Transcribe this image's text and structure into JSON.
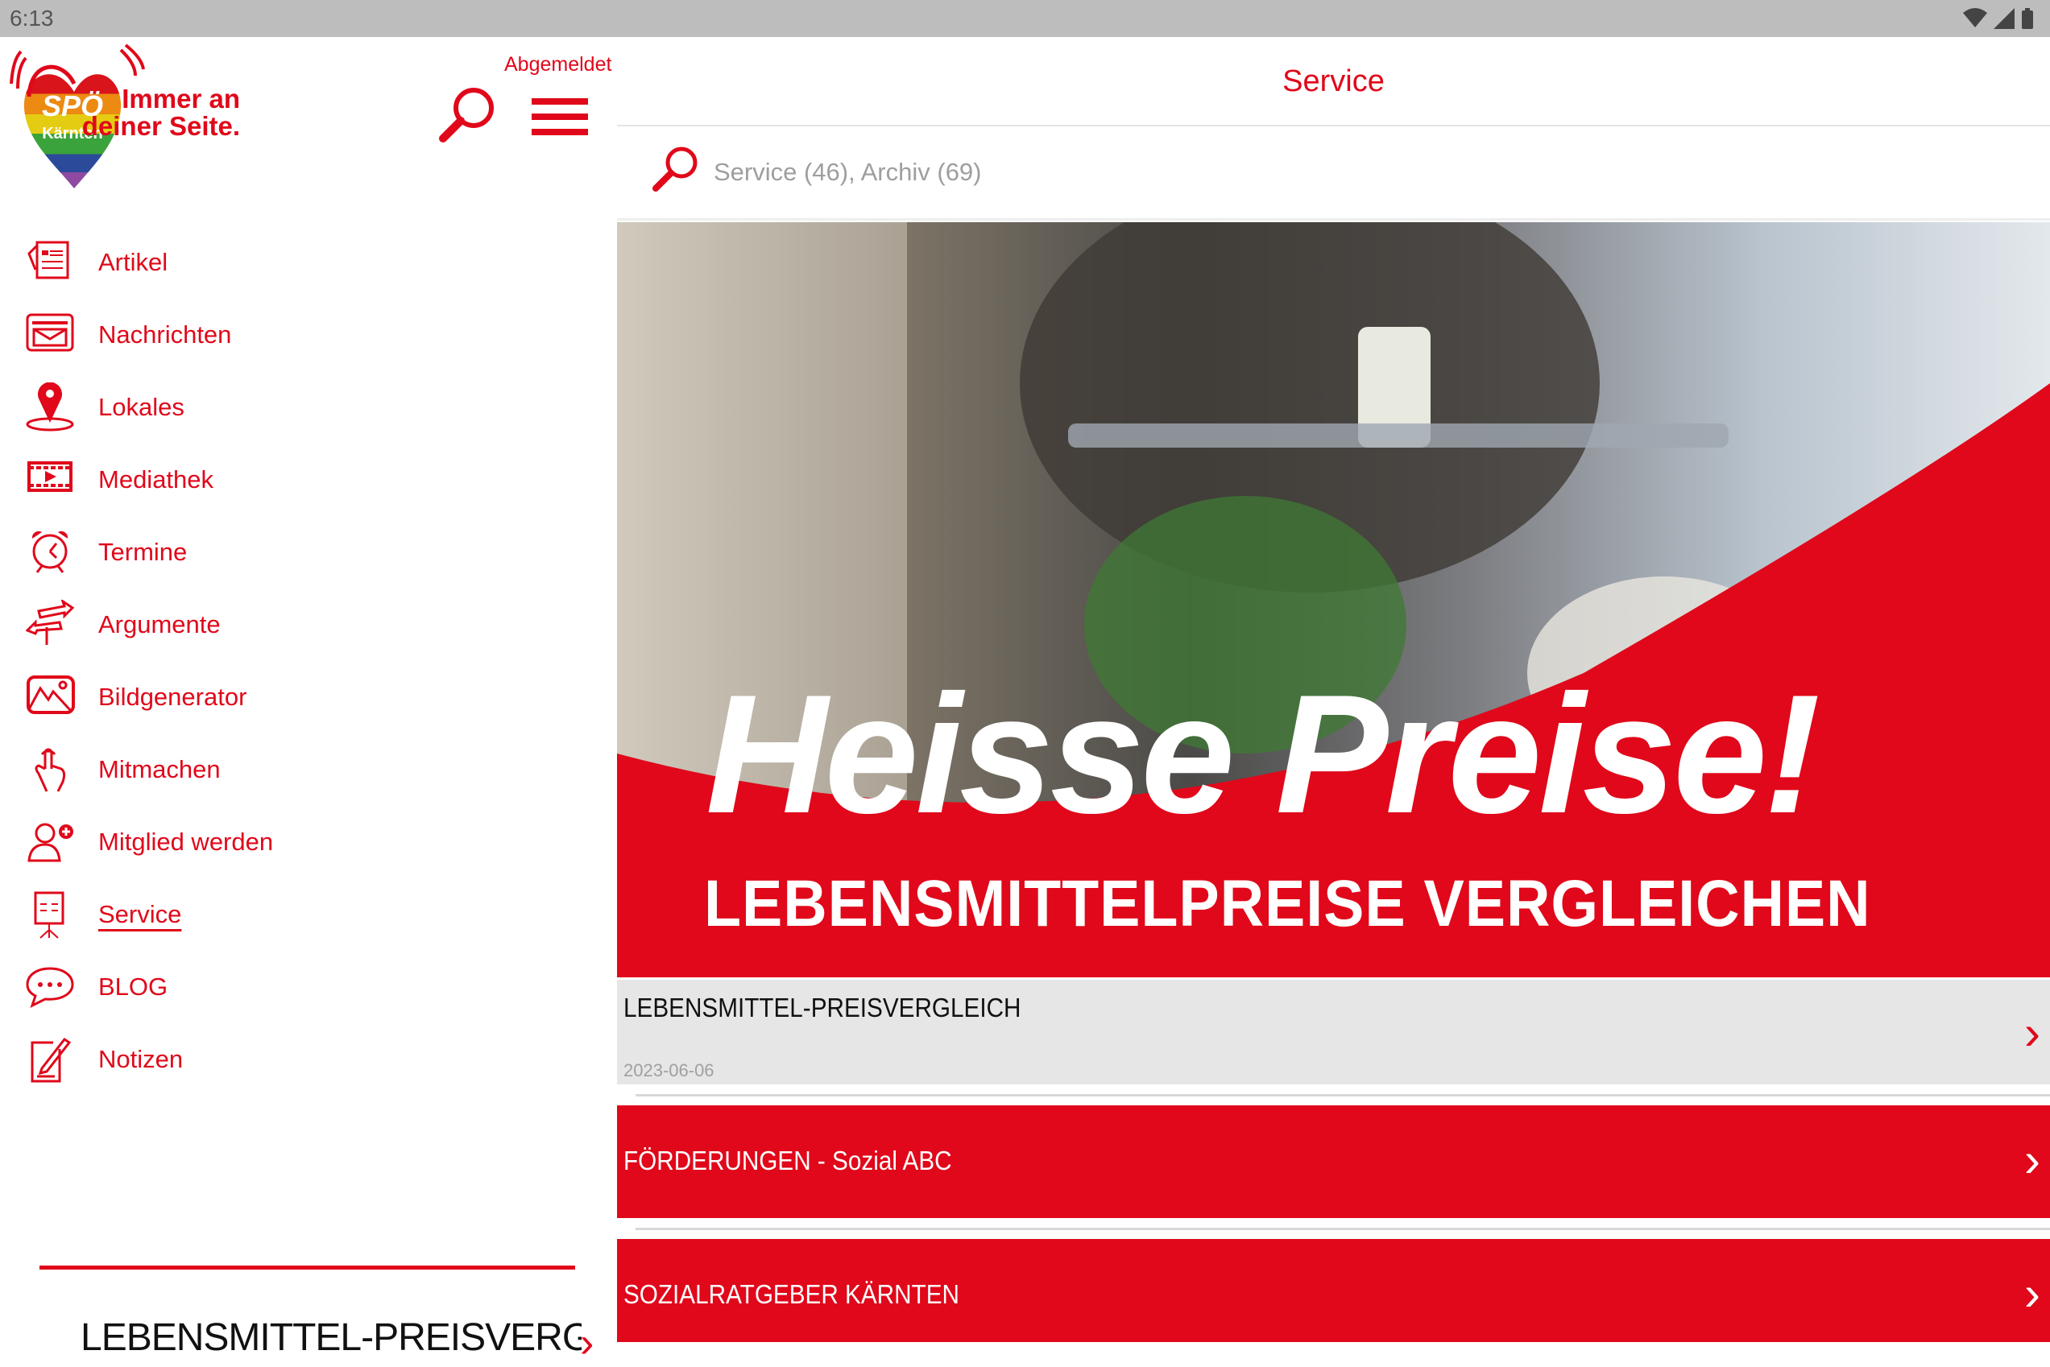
{
  "status_bar": {
    "time": "6:13"
  },
  "sidebar": {
    "logo": {
      "brand": "SPÖ",
      "region": "Kärnten",
      "slogan_line1": "Immer an",
      "slogan_line2": "deiner Seite."
    },
    "login_status": "Abgemeldet",
    "items": [
      {
        "label": "Artikel",
        "icon": "newspaper-icon"
      },
      {
        "label": "Nachrichten",
        "icon": "mail-icon"
      },
      {
        "label": "Lokales",
        "icon": "map-pin-icon"
      },
      {
        "label": "Mediathek",
        "icon": "film-icon"
      },
      {
        "label": "Termine",
        "icon": "alarm-clock-icon"
      },
      {
        "label": "Argumente",
        "icon": "signpost-icon"
      },
      {
        "label": "Bildgenerator",
        "icon": "image-icon"
      },
      {
        "label": "Mitmachen",
        "icon": "hand-pointer-icon"
      },
      {
        "label": "Mitglied werden",
        "icon": "add-user-icon"
      },
      {
        "label": "Service",
        "icon": "presentation-icon",
        "active": true
      },
      {
        "label": "BLOG",
        "icon": "chat-bubble-icon"
      },
      {
        "label": "Notizen",
        "icon": "notepad-icon"
      }
    ],
    "current_item": "LEBENSMITTEL-PREISVERGI"
  },
  "main": {
    "title": "Service",
    "search_placeholder": "Service (46), Archiv (69)",
    "banner": {
      "headline": "Heisse Preise!",
      "subline": "LEBENSMITTELPREISE VERGLEICHEN"
    },
    "list": [
      {
        "title": "LEBENSMITTEL-PREISVERGLEICH",
        "date": "2023-06-06"
      },
      {
        "title": "FÖRDERUNGEN - Sozial ABC"
      },
      {
        "title": "SOZIALRATGEBER KÄRNTEN"
      }
    ]
  },
  "colors": {
    "accent": "#e0081a",
    "status_bar": "#bdbdbd",
    "selected_row": "#e6e6e6"
  }
}
